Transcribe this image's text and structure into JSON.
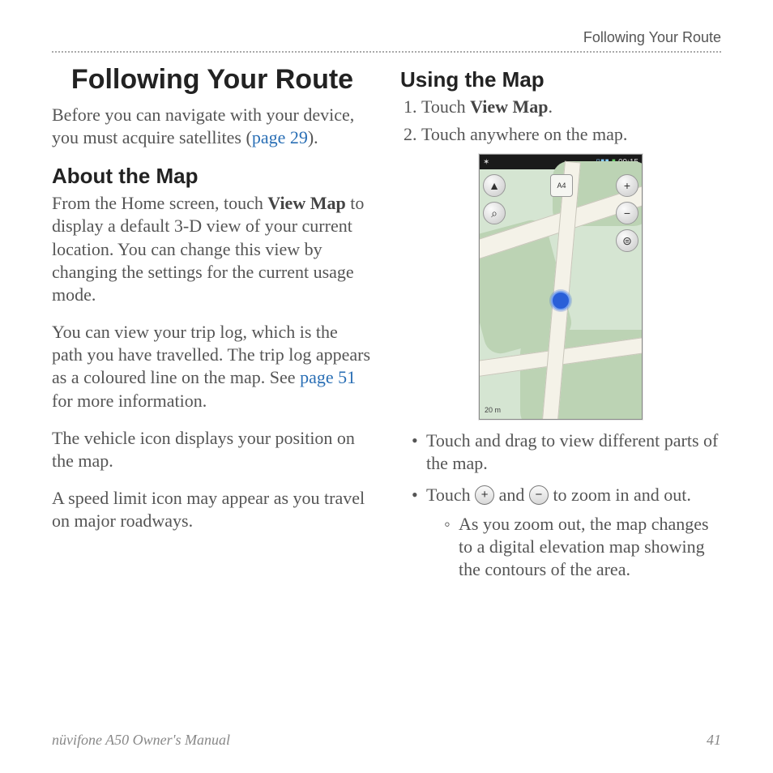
{
  "runningHead": "Following Your Route",
  "title": "Following Your Route",
  "intro": {
    "before": "Before you can navigate with your device, you must acquire satellites (",
    "link": "page 29",
    "after": ")."
  },
  "about": {
    "heading": "About the Map",
    "p1_pre": "From the Home screen, touch ",
    "p1_bold": "View Map",
    "p1_post": " to display a default 3-D view of your current location. You can change this view by changing the settings for the current usage mode.",
    "p2_pre": "You can view your trip log, which is the path you have travelled. The trip log appears as a coloured line on the map. See ",
    "p2_link": "page 51",
    "p2_post": " for more information.",
    "p3": "The vehicle icon displays your position on the map.",
    "p4": "A speed limit icon may appear as you travel on major roadways."
  },
  "using": {
    "heading": "Using the Map",
    "step1_pre": "Touch ",
    "step1_bold": "View Map",
    "step1_post": ".",
    "step2": "Touch anywhere on the map.",
    "bullet1": "Touch and drag to view different parts of the map.",
    "bullet2_pre": "Touch ",
    "bullet2_mid": " and ",
    "bullet2_post": " to zoom in and out.",
    "sub1": "As you zoom out, the map changes to a digital elevation map showing the contours of the area."
  },
  "device": {
    "time": "09:15",
    "scale": "20 m",
    "route_label": "A4"
  },
  "footer": {
    "left": "nüvifone A50 Owner's Manual",
    "right": "41"
  }
}
